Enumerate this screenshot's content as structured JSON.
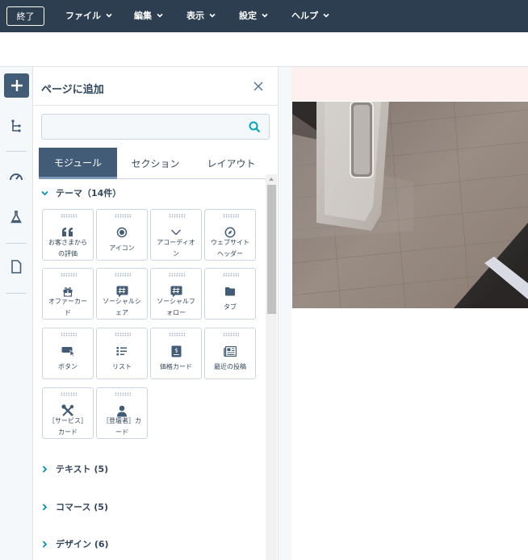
{
  "topbar": {
    "exit_label": "終了",
    "menus": [
      {
        "label": "ファイル"
      },
      {
        "label": "編集"
      },
      {
        "label": "表示"
      },
      {
        "label": "設定"
      },
      {
        "label": "ヘルプ"
      }
    ]
  },
  "panel": {
    "title": "ページに追加",
    "search": {
      "value": "",
      "placeholder": ""
    },
    "tabs": [
      {
        "label": "モジュール",
        "active": true
      },
      {
        "label": "セクション",
        "active": false
      },
      {
        "label": "レイアウト",
        "active": false
      }
    ],
    "theme_section": {
      "label": "テーマ（14件）",
      "modules": [
        {
          "line1": "お客さまから",
          "line2": "の評価",
          "icon": "quote-icon"
        },
        {
          "line1": "アイコン",
          "line2": "",
          "icon": "target-icon"
        },
        {
          "line1": "アコーディオ",
          "line2": "ン",
          "icon": "chevron-down-icon"
        },
        {
          "line1": "ウェブサイト",
          "line2": "ヘッダー",
          "icon": "compass-icon"
        },
        {
          "line1": "オファーカー",
          "line2": "ド",
          "icon": "gift-icon"
        },
        {
          "line1": "ソーシャルシ",
          "line2": "ェア",
          "icon": "hash-icon"
        },
        {
          "line1": "ソーシャルフ",
          "line2": "ォロー",
          "icon": "hash-icon"
        },
        {
          "line1": "タブ",
          "line2": "",
          "icon": "folder-icon"
        },
        {
          "line1": "ボタン",
          "line2": "",
          "icon": "button-cursor-icon"
        },
        {
          "line1": "リスト",
          "line2": "",
          "icon": "list-icon"
        },
        {
          "line1": "価格カード",
          "line2": "",
          "icon": "pricing-icon"
        },
        {
          "line1": "最近の投稿",
          "line2": "",
          "icon": "newspaper-icon"
        },
        {
          "line1": "［サービス］",
          "line2": "カード",
          "icon": "tools-icon"
        },
        {
          "line1": "［登壇者］カ",
          "line2": "ード",
          "icon": "person-icon"
        }
      ]
    },
    "other_sections": [
      {
        "label": "テキスト (5)"
      },
      {
        "label": "コマース (5)"
      },
      {
        "label": "デザイン (6)"
      }
    ]
  },
  "colors": {
    "topbar_bg": "#2d3e50",
    "accent": "#425b76",
    "search_icon": "#00a4bd"
  }
}
